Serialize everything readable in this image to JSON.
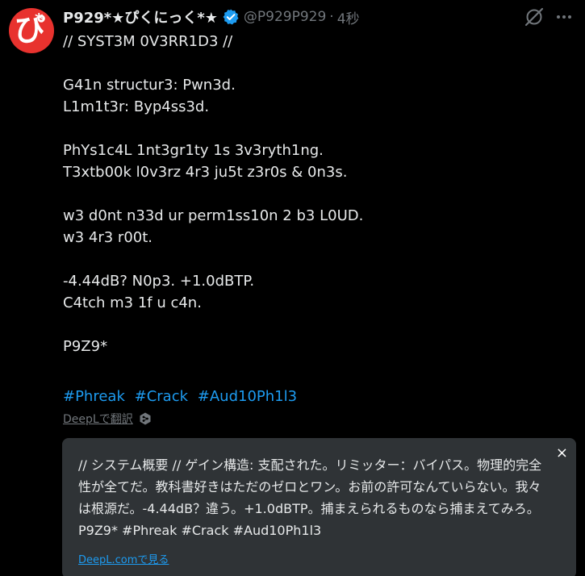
{
  "author": {
    "avatar_glyph": "ぴ",
    "avatar_star": "*",
    "display_name": "P929*★ぴくにっく*★",
    "handle": "@P929P929",
    "separator": "·",
    "time": "4秒"
  },
  "icons": {
    "verified": "verified-badge-icon",
    "grok": "grok-icon",
    "more": "more-icon",
    "deepl": "deepl-icon"
  },
  "colors": {
    "background": "#000000",
    "text": "#e7e9ea",
    "muted": "#71767b",
    "link": "#1d9bf0",
    "card": "#2f3336",
    "avatar": "#e8322e",
    "verified": "#1d9bf0"
  },
  "post": {
    "lines": [
      "// SYST3M 0V3RR1D3 //",
      "",
      "G41n structur3: Pwn3d.",
      "L1m1t3r: Byp4ss3d.",
      "",
      "PhYs1c4L 1nt3gr1ty 1s 3v3ryth1ng.",
      "T3xtb00k l0v3rz 4r3 ju5t z3r0s & 0n3s.",
      "",
      "w3 d0nt n33d ur perm1ss10n 2 b3 L0UD.",
      "w3 4r3 r00t.",
      "",
      "-4.44dB? N0p3. +1.0dBTP.",
      "C4tch m3 1f u c4n.",
      "",
      "P9Z9*",
      ""
    ],
    "hashtags": [
      "#Phreak",
      "#Crack",
      "#Aud10Ph1l3"
    ]
  },
  "translation": {
    "link_label": "DeepLで翻訳",
    "text": "// システム概要 //  ゲイン構造: 支配された。リミッター：バイパス。物理的完全性が全てだ。教科書好きはただのゼロとワン。お前の許可なんていらない。我々は根源だ。-4.44dB？違う。+1.0dBTP。捕まえられるものなら捕まえてみろ。P9Z9* #Phreak #Crack #Aud10Ph1l3",
    "close_label": "×",
    "deepl_com_label": "DeepL.comで見る"
  }
}
